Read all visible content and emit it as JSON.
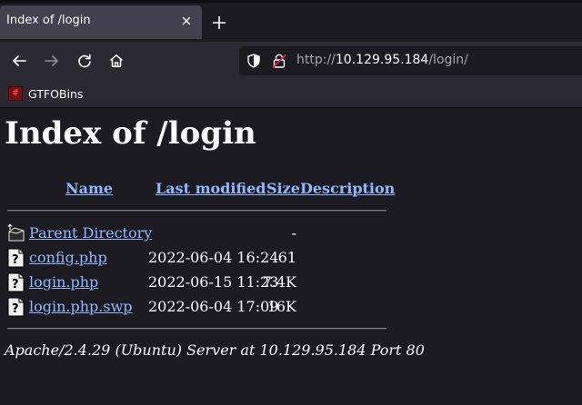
{
  "browser": {
    "tab": {
      "title": "Index of /login"
    },
    "url": {
      "scheme": "http://",
      "host": "10.129.95.184",
      "path": "/login/"
    },
    "bookmarks": [
      {
        "label": "GTFOBins",
        "favicon_glyph": "#"
      }
    ],
    "colors": {
      "link": "#8fb8ff",
      "chrome": "#2b2a33",
      "page_bg": "#1c1b22"
    }
  },
  "page": {
    "title": "Index of /login",
    "columns": {
      "name": "Name",
      "last_modified": "Last modified",
      "size": "Size",
      "description": "Description"
    },
    "entries": [
      {
        "name": "Parent Directory",
        "modified": "",
        "size": "-",
        "icon": "back-folder-icon"
      },
      {
        "name": "config.php",
        "modified": "2022-06-04 16:24",
        "size": "61",
        "icon": "file-icon"
      },
      {
        "name": "login.php",
        "modified": "2022-06-15 11:23",
        "size": "7.4K",
        "icon": "file-icon"
      },
      {
        "name": "login.php.swp",
        "modified": "2022-06-04 17:09",
        "size": "16K",
        "icon": "file-icon"
      }
    ],
    "address": "Apache/2.4.29 (Ubuntu) Server at 10.129.95.184 Port 80"
  }
}
